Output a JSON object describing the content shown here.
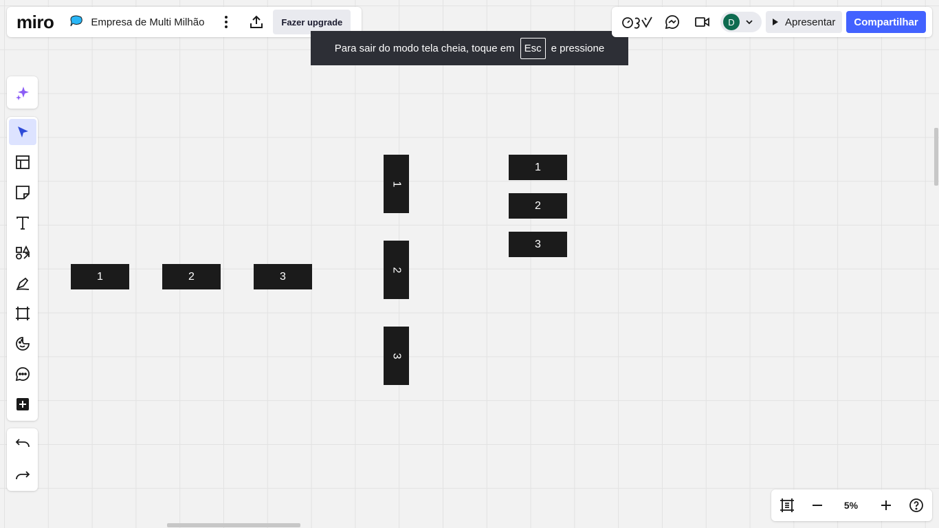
{
  "header": {
    "logo": "miro",
    "board_name": "Empresa de Multi Milhão",
    "upgrade_label": "Fazer upgrade"
  },
  "toast": {
    "text_before": "Para sair do modo tela cheia, toque em",
    "key": "Esc",
    "text_after": "e pressione"
  },
  "topright": {
    "avatar_initial": "D",
    "present_label": "Apresentar",
    "share_label": "Compartilhar"
  },
  "toolbar": {
    "tools": [
      "select-tool",
      "templates-tool",
      "sticky-note-tool",
      "text-tool",
      "shapes-tool",
      "pen-tool",
      "frame-tool",
      "stickers-tool",
      "comment-tool",
      "more-apps-tool"
    ]
  },
  "zoom": {
    "level": "5%"
  },
  "board": {
    "row_cards": [
      "1",
      "2",
      "3"
    ],
    "vertical_cards": [
      "1",
      "2",
      "3"
    ],
    "stack_cards": [
      "1",
      "2",
      "3"
    ]
  },
  "colors": {
    "accent": "#4262ff",
    "card": "#1b1b1b",
    "toast": "#2d2f36",
    "avatar": "#0e6b50",
    "ai_purple": "#8b5cf6"
  }
}
